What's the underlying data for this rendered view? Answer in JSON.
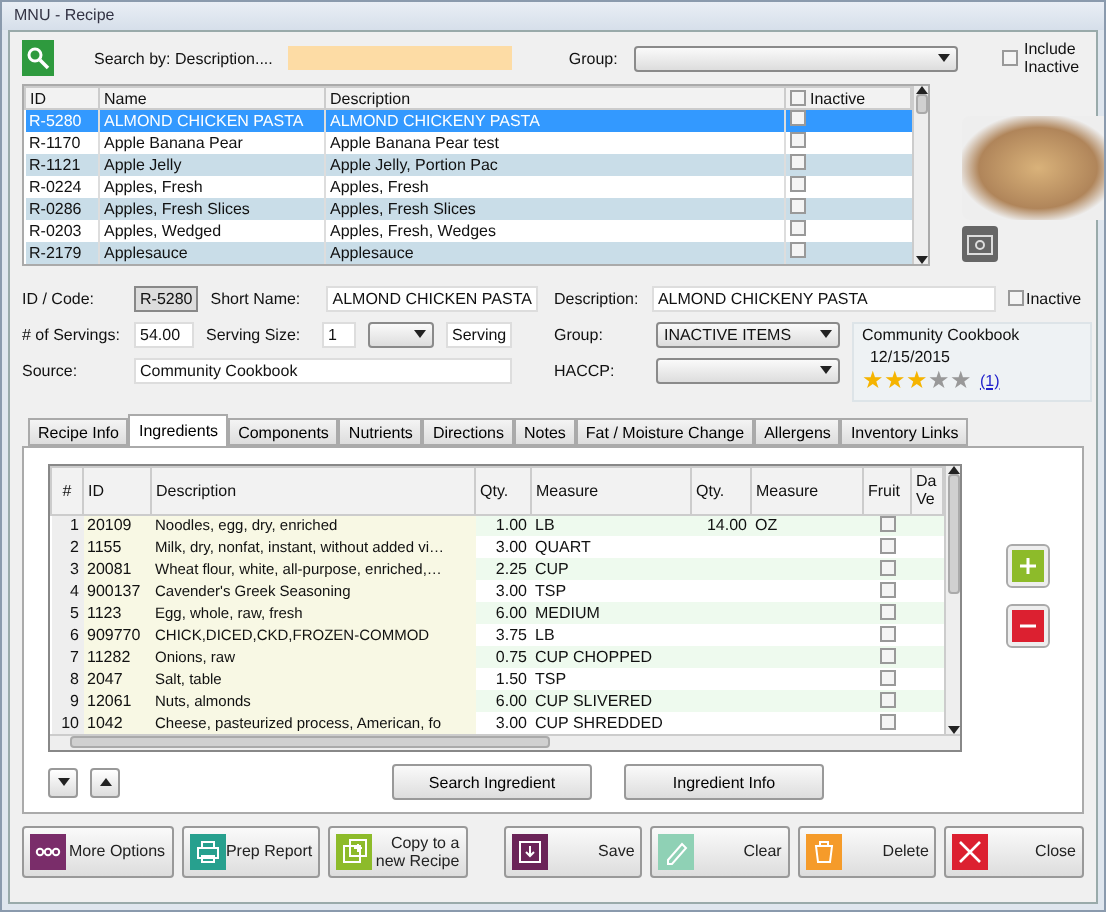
{
  "window": {
    "title": "MNU - Recipe"
  },
  "search": {
    "label": "Search by: Description....",
    "group_label": "Group:",
    "include_inactive": {
      "label": "Include Inactive",
      "checked": false
    }
  },
  "recipes": {
    "columns": [
      "ID",
      "Name",
      "Description",
      "Inactive"
    ],
    "all_inactive_checked": false,
    "rows": [
      {
        "id": "R-5280",
        "name": "ALMOND CHICKEN PASTA",
        "description": "ALMOND CHICKENY PASTA",
        "inactive": false,
        "selected": true
      },
      {
        "id": "R-1170",
        "name": "Apple Banana Pear",
        "description": "Apple Banana Pear test",
        "inactive": false,
        "selected": false
      },
      {
        "id": "R-1121",
        "name": "Apple Jelly",
        "description": "Apple Jelly, Portion Pac",
        "inactive": false,
        "selected": false
      },
      {
        "id": "R-0224",
        "name": "Apples, Fresh",
        "description": "Apples, Fresh",
        "inactive": false,
        "selected": false
      },
      {
        "id": "R-0286",
        "name": "Apples, Fresh Slices",
        "description": "Apples, Fresh Slices",
        "inactive": false,
        "selected": false
      },
      {
        "id": "R-0203",
        "name": "Apples, Wedged",
        "description": "Apples, Fresh, Wedges",
        "inactive": false,
        "selected": false
      },
      {
        "id": "R-2179",
        "name": "Applesauce",
        "description": "Applesauce",
        "inactive": false,
        "selected": false
      }
    ]
  },
  "form": {
    "id_label": "ID / Code:",
    "id": "R-5280",
    "short_name_label": "Short Name:",
    "short_name": "ALMOND CHICKEN PASTA",
    "description_label": "Description:",
    "description": "ALMOND CHICKENY PASTA",
    "inactive": {
      "label": "Inactive",
      "checked": false
    },
    "servings_label": "# of Servings:",
    "servings": "54.00",
    "serving_size_label": "Serving Size:",
    "serving_size": "1",
    "serving_unit": "Serving",
    "group_label": "Group:",
    "group": "INACTIVE ITEMS",
    "source_label": "Source:",
    "source": "Community Cookbook",
    "haccp_label": "HACCP:",
    "rating": {
      "title": "Community Cookbook",
      "date": "12/15/2015",
      "stars": 3,
      "count": "(1)"
    }
  },
  "tabs": [
    {
      "label": "Recipe Info",
      "selected": false
    },
    {
      "label": "Ingredients",
      "selected": true
    },
    {
      "label": "Components",
      "selected": false
    },
    {
      "label": "Nutrients",
      "selected": false
    },
    {
      "label": "Directions",
      "selected": false
    },
    {
      "label": "Notes",
      "selected": false
    },
    {
      "label": "Fat / Moisture Change",
      "selected": false
    },
    {
      "label": "Allergens",
      "selected": false
    },
    {
      "label": "Inventory Links",
      "selected": false
    }
  ],
  "ingredients": {
    "columns": [
      "#",
      "ID",
      "Description",
      "Qty.",
      "Measure",
      "Qty.",
      "Measure",
      "Fruit",
      "Da Ve"
    ],
    "rows": [
      {
        "n": "1",
        "id": "20109",
        "description": "Noodles, egg, dry, enriched",
        "qty": "1.00",
        "measure": "LB",
        "qty_2": "14.00",
        "measure_2": "OZ",
        "fruit": false
      },
      {
        "n": "2",
        "id": "1155",
        "description": "Milk, dry, nonfat, instant, without added vi…",
        "qty": "3.00",
        "measure": "QUART",
        "fruit": false
      },
      {
        "n": "3",
        "id": "20081",
        "description": "Wheat flour, white, all-purpose, enriched,…",
        "qty": "2.25",
        "measure": "CUP",
        "fruit": false
      },
      {
        "n": "4",
        "id": "900137",
        "description": "Cavender's Greek Seasoning",
        "qty": "3.00",
        "measure": "TSP",
        "fruit": false
      },
      {
        "n": "5",
        "id": "1123",
        "description": "Egg, whole, raw, fresh",
        "qty": "6.00",
        "measure": "MEDIUM",
        "fruit": false
      },
      {
        "n": "6",
        "id": "909770",
        "description": "CHICK,DICED,CKD,FROZEN-COMMOD",
        "qty": "3.75",
        "measure": "LB",
        "fruit": false
      },
      {
        "n": "7",
        "id": "11282",
        "description": "Onions, raw",
        "qty": "0.75",
        "measure": "CUP CHOPPED",
        "fruit": false
      },
      {
        "n": "8",
        "id": "2047",
        "description": "Salt, table",
        "qty": "1.50",
        "measure": "TSP",
        "fruit": false
      },
      {
        "n": "9",
        "id": "12061",
        "description": "Nuts, almonds",
        "qty": "6.00",
        "measure": "CUP SLIVERED",
        "fruit": false
      },
      {
        "n": "10",
        "id": "1042",
        "description": "Cheese, pasteurized process, American, fo",
        "qty": "3.00",
        "measure": "CUP SHREDDED",
        "fruit": false
      }
    ],
    "buttons": [
      "Search Ingredient",
      "Ingredient Info"
    ]
  },
  "actions": [
    {
      "kind": "more",
      "label": "More Options"
    },
    {
      "kind": "print",
      "label": "Prep Report"
    },
    {
      "kind": "copy",
      "label": "Copy to a new Recipe"
    },
    {
      "kind": "save",
      "label": "Save"
    },
    {
      "kind": "clear",
      "label": "Clear"
    },
    {
      "kind": "delete",
      "label": "Delete"
    },
    {
      "kind": "close",
      "label": "Close"
    }
  ]
}
